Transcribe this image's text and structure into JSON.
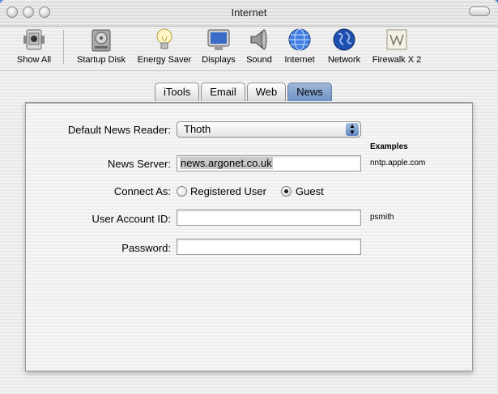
{
  "window": {
    "title": "Internet"
  },
  "toolbar": {
    "items": [
      {
        "label": "Show All",
        "icon": "apple-switch-icon"
      },
      {
        "label": "Startup Disk",
        "icon": "hard-disk-icon"
      },
      {
        "label": "Energy Saver",
        "icon": "lightbulb-icon"
      },
      {
        "label": "Displays",
        "icon": "monitor-icon"
      },
      {
        "label": "Sound",
        "icon": "speaker-icon"
      },
      {
        "label": "Internet",
        "icon": "globe-icon"
      },
      {
        "label": "Network",
        "icon": "earth-icon"
      },
      {
        "label": "Firewalk X 2",
        "icon": "firewalk-icon"
      }
    ]
  },
  "tabs": [
    {
      "label": "iTools",
      "active": false
    },
    {
      "label": "Email",
      "active": false
    },
    {
      "label": "Web",
      "active": false
    },
    {
      "label": "News",
      "active": true
    }
  ],
  "form": {
    "reader_label": "Default News Reader:",
    "reader_value": "Thoth",
    "examples_heading": "Examples",
    "server_label": "News Server:",
    "server_value": "news.argonet.co.uk",
    "server_example": "nntp.apple.com",
    "connect_label": "Connect As:",
    "radio_registered": "Registered User",
    "radio_guest": "Guest",
    "selected_connection": "Guest",
    "account_label": "User Account ID:",
    "account_value": "",
    "account_example": "psmith",
    "password_label": "Password:",
    "password_value": ""
  }
}
